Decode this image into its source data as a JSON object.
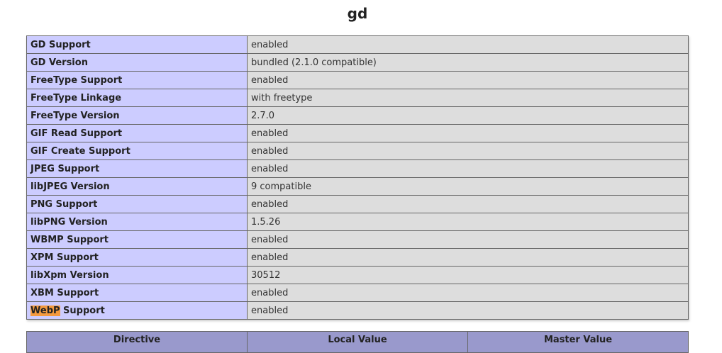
{
  "module_title": "gd",
  "rows": [
    {
      "label_pre": "",
      "label_highlight": "",
      "label_post": "GD Support",
      "value": "enabled"
    },
    {
      "label_pre": "",
      "label_highlight": "",
      "label_post": "GD Version",
      "value": "bundled (2.1.0 compatible)"
    },
    {
      "label_pre": "",
      "label_highlight": "",
      "label_post": "FreeType Support",
      "value": "enabled"
    },
    {
      "label_pre": "",
      "label_highlight": "",
      "label_post": "FreeType Linkage",
      "value": "with freetype"
    },
    {
      "label_pre": "",
      "label_highlight": "",
      "label_post": "FreeType Version",
      "value": "2.7.0"
    },
    {
      "label_pre": "",
      "label_highlight": "",
      "label_post": "GIF Read Support",
      "value": "enabled"
    },
    {
      "label_pre": "",
      "label_highlight": "",
      "label_post": "GIF Create Support",
      "value": "enabled"
    },
    {
      "label_pre": "",
      "label_highlight": "",
      "label_post": "JPEG Support",
      "value": "enabled"
    },
    {
      "label_pre": "",
      "label_highlight": "",
      "label_post": "libJPEG Version",
      "value": "9 compatible"
    },
    {
      "label_pre": "",
      "label_highlight": "",
      "label_post": "PNG Support",
      "value": "enabled"
    },
    {
      "label_pre": "",
      "label_highlight": "",
      "label_post": "libPNG Version",
      "value": "1.5.26"
    },
    {
      "label_pre": "",
      "label_highlight": "",
      "label_post": "WBMP Support",
      "value": "enabled"
    },
    {
      "label_pre": "",
      "label_highlight": "",
      "label_post": "XPM Support",
      "value": "enabled"
    },
    {
      "label_pre": "",
      "label_highlight": "",
      "label_post": "libXpm Version",
      "value": "30512"
    },
    {
      "label_pre": "",
      "label_highlight": "",
      "label_post": "XBM Support",
      "value": "enabled"
    },
    {
      "label_pre": "",
      "label_highlight": "WebP",
      "label_post": " Support",
      "value": "enabled"
    }
  ],
  "directive_table": {
    "headers": [
      "Directive",
      "Local Value",
      "Master Value"
    ]
  },
  "colors": {
    "label_cell": "#ccccff",
    "value_cell": "#dddddd",
    "header_cell": "#9999cc",
    "search_highlight": "#f49a3e"
  }
}
